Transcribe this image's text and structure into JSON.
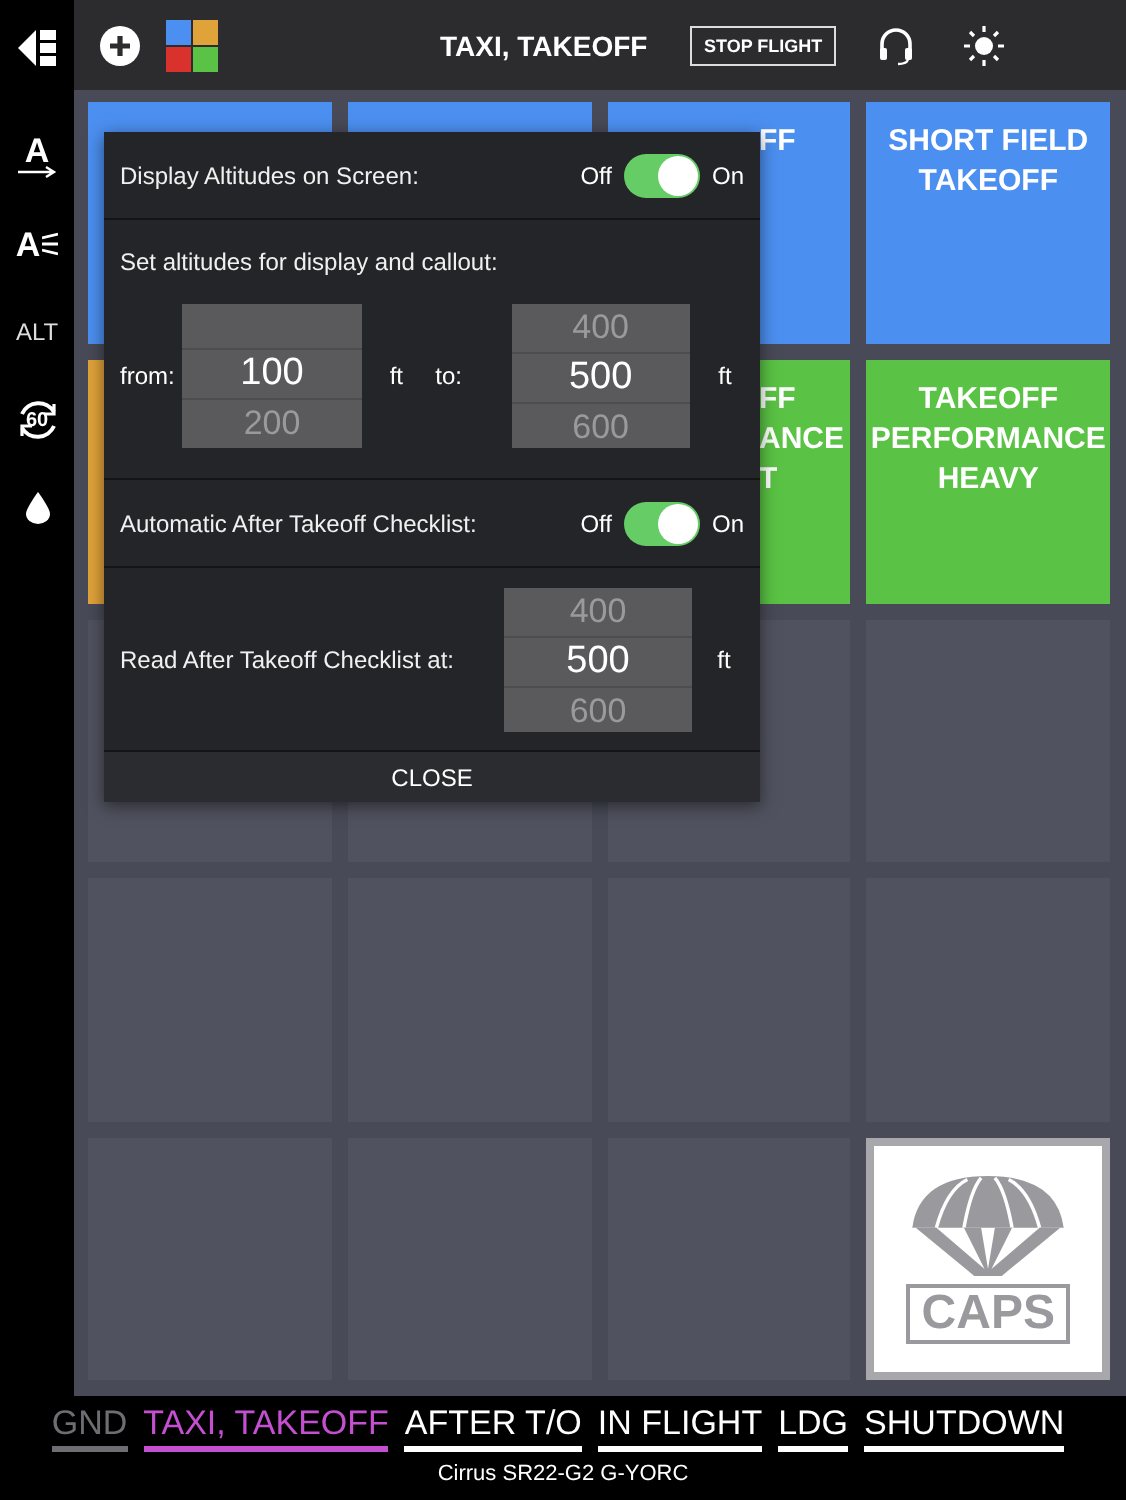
{
  "header": {
    "title": "TAXI, TAKEOFF",
    "stop_button": "STOP FLIGHT"
  },
  "sidebar": {
    "items": [
      {
        "kind": "text-arrow",
        "text": "A"
      },
      {
        "kind": "text-lines",
        "text": "A"
      },
      {
        "kind": "label",
        "text": "ALT"
      },
      {
        "kind": "timer",
        "text": "60"
      },
      {
        "kind": "drop"
      }
    ]
  },
  "tiles": [
    {
      "kind": "checklist",
      "color": "#4b8ff0"
    },
    {
      "kind": "checklist",
      "color": "#4b8ff0"
    },
    {
      "kind": "checklist",
      "color": "#4b8ff0",
      "lines": [
        "FF"
      ],
      "partial": true
    },
    {
      "kind": "checklist",
      "color": "#4b8ff0",
      "lines": [
        "SHORT FIELD",
        "TAKEOFF"
      ],
      "partial": false
    },
    {
      "kind": "checklist",
      "color": "#e0a33a"
    },
    {
      "kind": "covered"
    },
    {
      "kind": "checklist",
      "color": "#5ac244",
      "lines": [
        "FF",
        "ANCE",
        "T"
      ],
      "partial": true
    },
    {
      "kind": "checklist",
      "color": "#5ac244",
      "lines": [
        "TAKEOFF",
        "PERFORMANCE",
        "HEAVY"
      ],
      "partial": false
    },
    {
      "kind": "empty"
    },
    {
      "kind": "empty"
    },
    {
      "kind": "empty"
    },
    {
      "kind": "empty"
    },
    {
      "kind": "empty"
    },
    {
      "kind": "empty"
    },
    {
      "kind": "empty"
    },
    {
      "kind": "empty"
    },
    {
      "kind": "empty"
    },
    {
      "kind": "empty"
    },
    {
      "kind": "empty"
    },
    {
      "kind": "caps",
      "text": "CAPS"
    }
  ],
  "popup": {
    "display_toggle": {
      "label": "Display Altitudes on Screen:",
      "off_label": "Off",
      "on_label": "On",
      "on": true
    },
    "range_label": "Set altitudes for display and callout:",
    "from": {
      "label": "from:",
      "unit": "ft",
      "values": [
        {
          "text": "100",
          "selected": true
        },
        {
          "text": "200",
          "selected": false
        }
      ]
    },
    "to": {
      "label": "to:",
      "unit": "ft",
      "values": [
        {
          "text": "400",
          "selected": false
        },
        {
          "text": "500",
          "selected": true
        },
        {
          "text": "600",
          "selected": false
        }
      ]
    },
    "auto_toggle": {
      "label": "Automatic After Takeoff Checklist:",
      "off_label": "Off",
      "on_label": "On",
      "on": true
    },
    "read_at": {
      "label": "Read After Takeoff Checklist at:",
      "unit": "ft",
      "values": [
        {
          "text": "400",
          "selected": false
        },
        {
          "text": "500",
          "selected": true
        },
        {
          "text": "600",
          "selected": false
        }
      ]
    },
    "close": "CLOSE"
  },
  "phases": [
    {
      "label": "GND",
      "selected": false,
      "disabled": true
    },
    {
      "label": "TAXI, TAKEOFF",
      "selected": true,
      "disabled": false
    },
    {
      "label": "AFTER T/O",
      "selected": false,
      "disabled": false
    },
    {
      "label": "IN FLIGHT",
      "selected": false,
      "disabled": false
    },
    {
      "label": "LDG",
      "selected": false,
      "disabled": false
    },
    {
      "label": "SHUTDOWN",
      "selected": false,
      "disabled": false
    }
  ],
  "aircraft": "Cirrus SR22-G2 G-YORC"
}
